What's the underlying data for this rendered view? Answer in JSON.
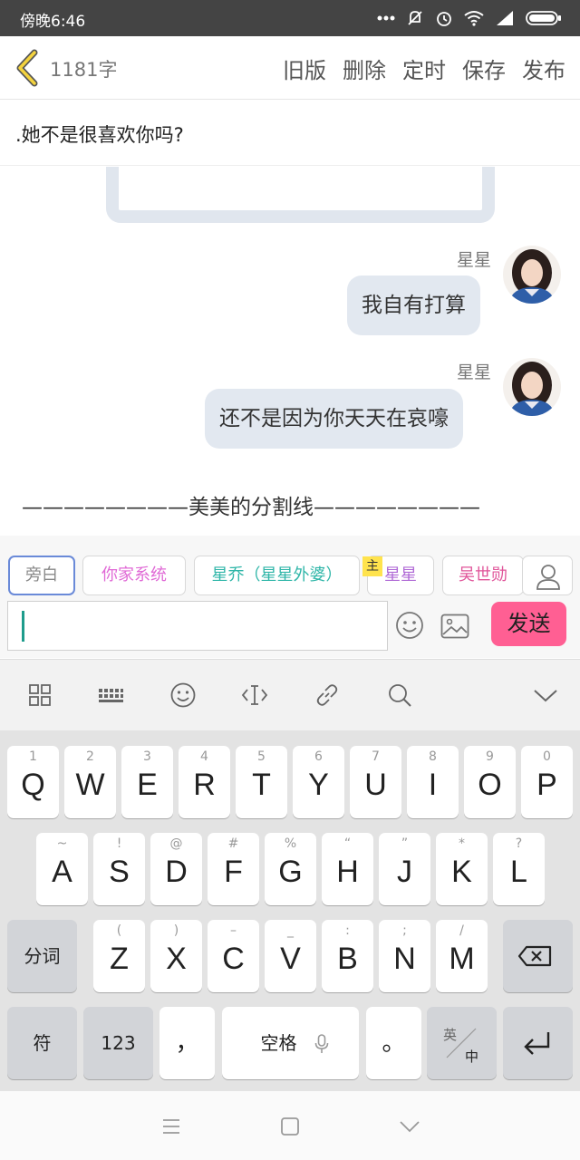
{
  "status": {
    "time": "傍晚6:46",
    "icons": [
      "more-dots-icon",
      "mute-icon",
      "alarm-icon",
      "wifi-icon",
      "signal-icon",
      "battery-icon"
    ]
  },
  "toolbar": {
    "word_count": "1181字",
    "actions": [
      "旧版",
      "删除",
      "定时",
      "保存",
      "发布"
    ]
  },
  "title": ".她不是很喜欢你吗?",
  "chat": {
    "messages": [
      {
        "speaker": "星星",
        "text": "我自有打算"
      },
      {
        "speaker": "星星",
        "text": "还不是因为你天天在哀嚎"
      }
    ],
    "divider": "————————美美的分割线————————"
  },
  "characters": {
    "chips": [
      "旁白",
      "你家系统",
      "星乔（星星外婆）",
      "星星",
      "吴世勋"
    ],
    "chip_colors": [
      "#888888",
      "#e06ad6",
      "#2fb6a8",
      "#b06ad6",
      "#e0559a"
    ],
    "main_badge": "主"
  },
  "input": {
    "value": "",
    "send_label": "发送",
    "accent": "#ff5f93"
  },
  "keyboard": {
    "row1": [
      {
        "hint": "1",
        "key": "Q"
      },
      {
        "hint": "2",
        "key": "W"
      },
      {
        "hint": "3",
        "key": "E"
      },
      {
        "hint": "4",
        "key": "R"
      },
      {
        "hint": "5",
        "key": "T"
      },
      {
        "hint": "6",
        "key": "Y"
      },
      {
        "hint": "7",
        "key": "U"
      },
      {
        "hint": "8",
        "key": "I"
      },
      {
        "hint": "9",
        "key": "O"
      },
      {
        "hint": "0",
        "key": "P"
      }
    ],
    "row2": [
      {
        "hint": "~",
        "key": "A"
      },
      {
        "hint": "!",
        "key": "S"
      },
      {
        "hint": "@",
        "key": "D"
      },
      {
        "hint": "#",
        "key": "F"
      },
      {
        "hint": "%",
        "key": "G"
      },
      {
        "hint": "“",
        "key": "H"
      },
      {
        "hint": "”",
        "key": "J"
      },
      {
        "hint": "*",
        "key": "K"
      },
      {
        "hint": "?",
        "key": "L"
      }
    ],
    "row3": [
      {
        "hint": "(",
        "key": "Z"
      },
      {
        "hint": ")",
        "key": "X"
      },
      {
        "hint": "–",
        "key": "C"
      },
      {
        "hint": "_",
        "key": "V"
      },
      {
        "hint": ":",
        "key": "B"
      },
      {
        "hint": ";",
        "key": "N"
      },
      {
        "hint": "/",
        "key": "M"
      }
    ],
    "fenci": "分词",
    "fu": "符",
    "num": "123",
    "comma": "，",
    "space": "空格",
    "period": "。",
    "lang_top": "英",
    "lang_bottom": "中"
  }
}
